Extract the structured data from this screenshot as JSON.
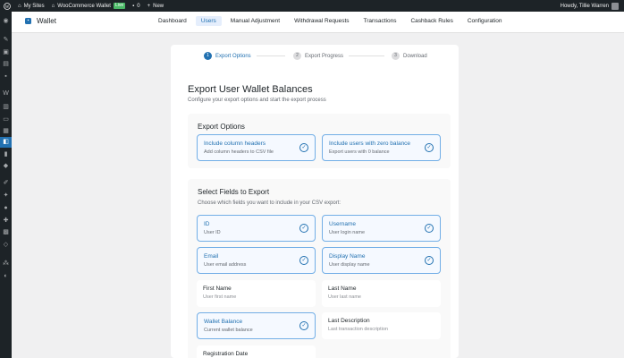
{
  "admin_bar": {
    "my_sites": "My Sites",
    "site_name": "WooCommerce Wallet",
    "live_badge": "Live",
    "comments_count": "0",
    "new_label": "New",
    "greeting": "Howdy, Tillie Warren"
  },
  "nav": {
    "brand": "Wallet",
    "tabs": [
      {
        "label": "Dashboard"
      },
      {
        "label": "Users"
      },
      {
        "label": "Manual Adjustment"
      },
      {
        "label": "Withdrawal Requests"
      },
      {
        "label": "Transactions"
      },
      {
        "label": "Cashback Rules"
      },
      {
        "label": "Configuration"
      }
    ],
    "active_tab": "Users"
  },
  "stepper": {
    "steps": [
      {
        "num": "1",
        "label": "Export Options"
      },
      {
        "num": "2",
        "label": "Export Progress"
      },
      {
        "num": "3",
        "label": "Download"
      }
    ]
  },
  "page": {
    "title": "Export User Wallet Balances",
    "subtitle": "Configure your export options and start the export process"
  },
  "export_options": {
    "title": "Export Options",
    "options": [
      {
        "label": "Include column headers",
        "sub": "Add column headers to CSV file",
        "selected": true
      },
      {
        "label": "Include users with zero balance",
        "sub": "Export users with 0 balance",
        "selected": true
      }
    ]
  },
  "fields": {
    "title": "Select Fields to Export",
    "desc": "Choose which fields you want to include in your CSV export:",
    "items": [
      {
        "label": "ID",
        "sub": "User ID",
        "selected": true
      },
      {
        "label": "Username",
        "sub": "User login name",
        "selected": true
      },
      {
        "label": "Email",
        "sub": "User email address",
        "selected": true
      },
      {
        "label": "Display Name",
        "sub": "User display name",
        "selected": true
      },
      {
        "label": "First Name",
        "sub": "User first name",
        "selected": false
      },
      {
        "label": "Last Name",
        "sub": "User last name",
        "selected": false
      },
      {
        "label": "Wallet Balance",
        "sub": "Current wallet balance",
        "selected": true
      },
      {
        "label": "Last Description",
        "sub": "Last transaction description",
        "selected": false
      },
      {
        "label": "Registration Date",
        "sub": "",
        "selected": false
      }
    ]
  },
  "colors": {
    "accent": "#2271b1",
    "admin_bar": "#1d2327",
    "selected_border": "#72aee6"
  }
}
